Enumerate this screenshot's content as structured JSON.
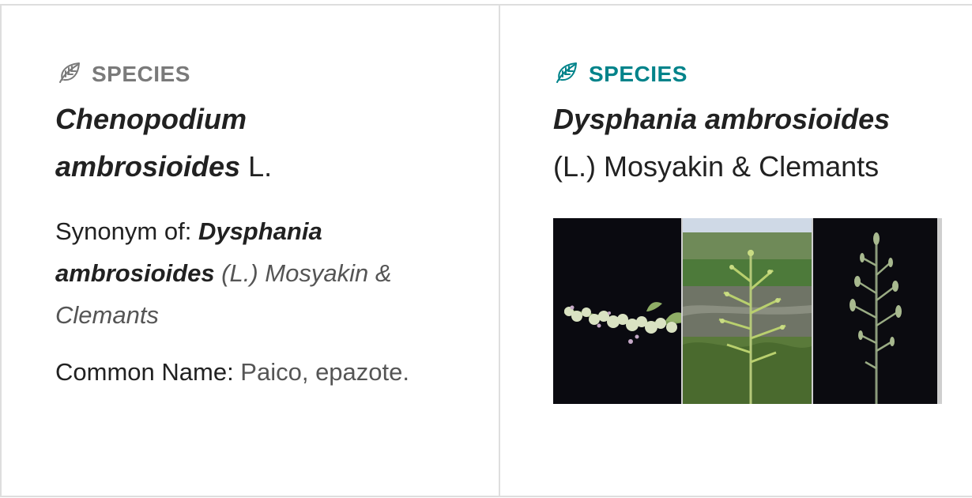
{
  "cards": [
    {
      "eyebrow": "SPECIES",
      "name_line1": "Chenopodium",
      "name_line2_italic": "ambrosioides",
      "name_line2_author": " L.",
      "synonym": {
        "label": "Synonym of",
        "sep": ": ",
        "binomial": "Dysphania ambrosioides",
        "author": " (L.) Mosyakin & Clemants"
      },
      "common_name": {
        "label": "Common Name",
        "sep": ": ",
        "value": "Paico, epazote."
      }
    },
    {
      "eyebrow": "SPECIES",
      "name_line1": "Dysphania ambrosioides",
      "name_line2_author": "(L.) Mosyakin & Clemants"
    }
  ],
  "colors": {
    "eyebrow_muted": "#7a7a7a",
    "eyebrow_accent": "#00838a",
    "border": "#dedede"
  },
  "icons": [
    "leaf-icon",
    "leaf-icon"
  ]
}
